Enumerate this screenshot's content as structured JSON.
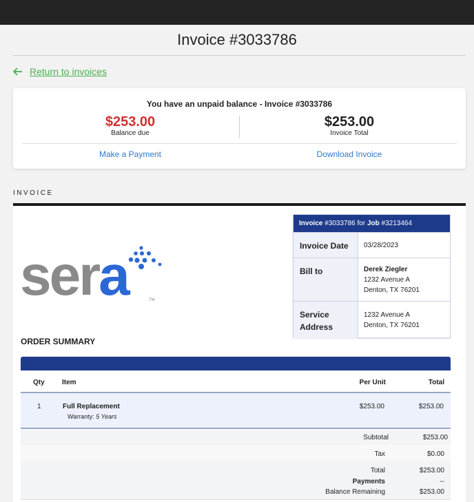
{
  "page": {
    "title": "Invoice #3033786"
  },
  "back_link": {
    "label": "Return to invoices"
  },
  "balance_card": {
    "headline": "You have an unpaid balance - Invoice #3033786",
    "balance_due": "$253.00",
    "balance_due_label": "Balance due",
    "invoice_total": "$253.00",
    "invoice_total_label": "Invoice Total",
    "make_payment": "Make a Payment",
    "download_invoice": "Download Invoice"
  },
  "invoice_section": {
    "label": "INVOICE"
  },
  "logo": {
    "text_grey": "ser",
    "text_blue": "a",
    "tm": "TM"
  },
  "info_box": {
    "invoice_word": "Invoice",
    "invoice_number": "#3033786",
    "for_word": "for",
    "job_word": "Job",
    "job_number": "#3213464",
    "invoice_date_label": "Invoice Date",
    "invoice_date": "03/28/2023",
    "bill_to_label": "Bill to",
    "bill_to_name": "Derek Ziegler",
    "bill_to_line1": "1232 Avenue A",
    "bill_to_line2": "Denton, TX 76201",
    "service_label_1": "Service",
    "service_label_2": "Address",
    "service_line1": "1232 Avenue A",
    "service_line2": "Denton, TX 76201"
  },
  "order_summary": {
    "title": "ORDER SUMMARY",
    "headers": {
      "qty": "Qty",
      "item": "Item",
      "per_unit": "Per Unit",
      "total": "Total"
    },
    "rows": [
      {
        "qty": "1",
        "item": "Full Replacement",
        "warranty_label": "Warranty:",
        "warranty_value": "5 Years",
        "per_unit": "$253.00",
        "total": "$253.00"
      }
    ],
    "totals": {
      "subtotal_label": "Subtotal",
      "subtotal": "$253.00",
      "tax_label": "Tax",
      "tax": "$0.00",
      "total_label": "Total",
      "total": "$253.00",
      "payments_label": "Payments",
      "payments": "--",
      "remaining_label": "Balance Remaining",
      "remaining": "$253.00"
    }
  },
  "colors": {
    "accent_green": "#4caf50",
    "due_red": "#d32f2f",
    "link_blue": "#2e79c7",
    "navy": "#1e3a8a",
    "logo_blue": "#2c67d6",
    "logo_grey": "#8a8a8a"
  }
}
